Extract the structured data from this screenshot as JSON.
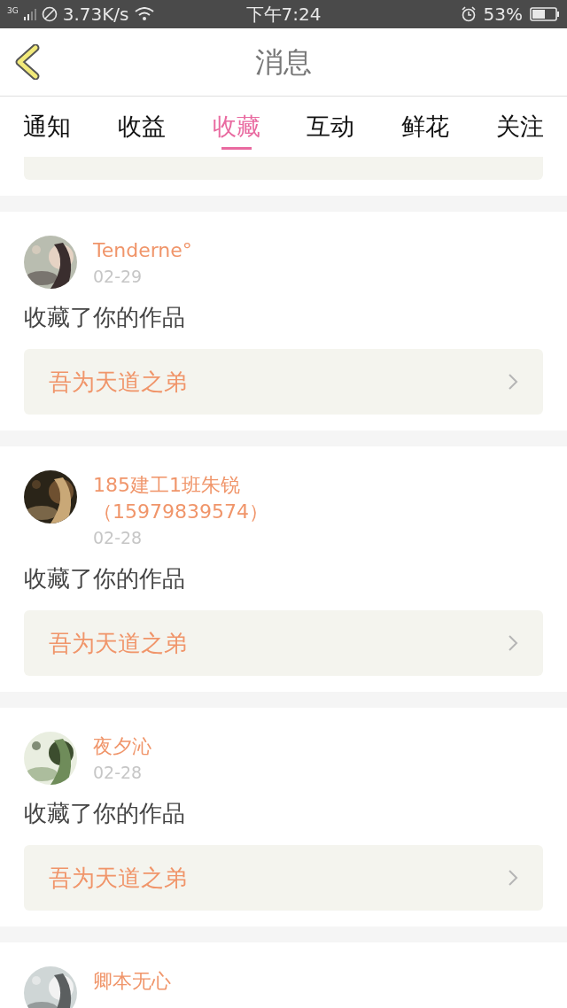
{
  "status_bar": {
    "network": "3G",
    "speed": "3.73K/s",
    "time": "下午7:24",
    "battery": "53%"
  },
  "header": {
    "title": "消息"
  },
  "tabs": [
    {
      "label": "通知",
      "selected": false
    },
    {
      "label": "收益",
      "selected": false
    },
    {
      "label": "收藏",
      "selected": true
    },
    {
      "label": "互动",
      "selected": false
    },
    {
      "label": "鲜花",
      "selected": false
    },
    {
      "label": "关注",
      "selected": false
    }
  ],
  "items": [
    {
      "name": "Tenderne°",
      "date": "02-29",
      "action": "收藏了你的作品",
      "work": "吾为天道之弟"
    },
    {
      "name": "185建工1班朱锐（15979839574）",
      "date": "02-28",
      "action": "收藏了你的作品",
      "work": "吾为天道之弟"
    },
    {
      "name": "夜夕沁",
      "date": "02-28",
      "action": "收藏了你的作品",
      "work": "吾为天道之弟"
    },
    {
      "name": "卿本无心"
    }
  ]
}
